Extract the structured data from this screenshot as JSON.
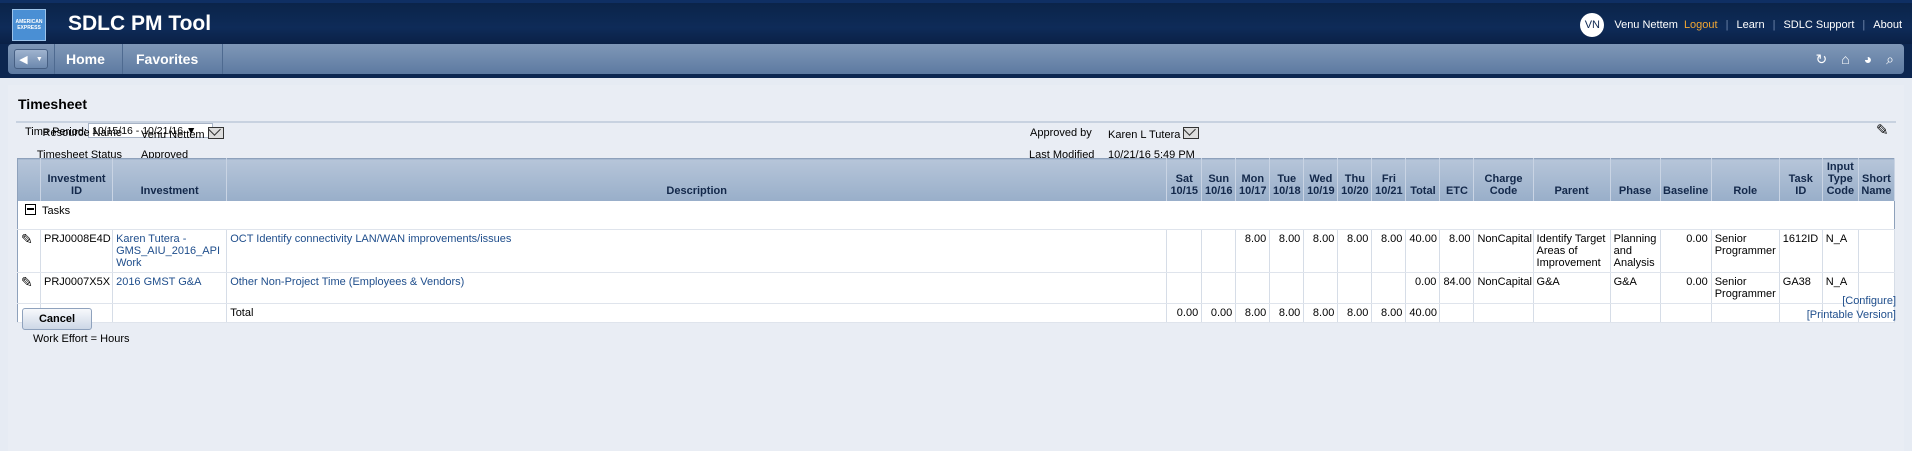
{
  "header": {
    "logo_text": "AMERICAN EXPRESS",
    "app_title": "SDLC PM Tool",
    "avatar_initials": "VN",
    "user_name": "Venu Nettem",
    "logout": "Logout",
    "links": [
      "Learn",
      "SDLC Support",
      "About"
    ]
  },
  "nav": {
    "back_icon": "back-arrow-icon",
    "items": [
      "Home",
      "Favorites"
    ],
    "icons": [
      "refresh-icon",
      "home-icon",
      "globe-icon",
      "search-icon"
    ]
  },
  "page": {
    "title": "Timesheet",
    "time_period_label": "Time Period:",
    "time_period_value": "10/15/16 - 10/21/16 ▼",
    "fields": {
      "resource_name_label": "Resource Name",
      "resource_name_value": "Venu Nettem",
      "status_label": "Timesheet Status",
      "status_value": "Approved",
      "approved_by_label": "Approved by",
      "approved_by_value": "Karen L Tutera",
      "last_modified_label": "Last Modified",
      "last_modified_value": "10/21/16 5:49 PM"
    }
  },
  "table": {
    "columns": [
      "",
      "Investment ID",
      "Investment",
      "Description",
      "Sat 10/15",
      "Sun 10/16",
      "Mon 10/17",
      "Tue 10/18",
      "Wed 10/19",
      "Thu 10/20",
      "Fri 10/21",
      "Total",
      "ETC",
      "Charge Code",
      "Parent",
      "Phase",
      "Baseline",
      "Role",
      "Task ID",
      "Input Type Code",
      "Short Name"
    ],
    "section_label": "Tasks",
    "rows": [
      {
        "investment_id": "PRJ0008E4D",
        "investment": "Karen Tutera - GMS_AIU_2016_API Work",
        "description": "OCT Identify connectivity LAN/WAN improvements/issues",
        "sat": "",
        "sun": "",
        "mon": "8.00",
        "tue": "8.00",
        "wed": "8.00",
        "thu": "8.00",
        "fri": "8.00",
        "total": "40.00",
        "etc": "8.00",
        "charge_code": "NonCapital",
        "parent": "Identify Target Areas of Improvement",
        "phase": "Planning and Analysis",
        "baseline": "0.00",
        "role": "Senior Programmer",
        "task_id": "1612ID",
        "input_type_code": "N_A",
        "short_name": ""
      },
      {
        "investment_id": "PRJ0007X5X",
        "investment": "2016 GMST G&A",
        "description": "Other Non-Project Time (Employees & Vendors)",
        "sat": "",
        "sun": "",
        "mon": "",
        "tue": "",
        "wed": "",
        "thu": "",
        "fri": "",
        "total": "0.00",
        "etc": "84.00",
        "charge_code": "NonCapital",
        "parent": "G&A",
        "phase": "G&A",
        "baseline": "0.00",
        "role": "Senior Programmer",
        "task_id": "GA38",
        "input_type_code": "N_A",
        "short_name": ""
      }
    ],
    "total_row": {
      "label": "Total",
      "sat": "0.00",
      "sun": "0.00",
      "mon": "8.00",
      "tue": "8.00",
      "wed": "8.00",
      "thu": "8.00",
      "fri": "8.00",
      "total": "40.00"
    }
  },
  "footer": {
    "configure": "[Configure]",
    "printable": "[Printable Version]",
    "cancel": "Cancel",
    "note": "Work Effort = Hours"
  },
  "colors": {
    "header_bg": "#0e2b58",
    "nav_bg": "#6b86ab",
    "logout": "#f2a632",
    "link": "#1f4e8c",
    "table_header": "#a8bad2"
  }
}
